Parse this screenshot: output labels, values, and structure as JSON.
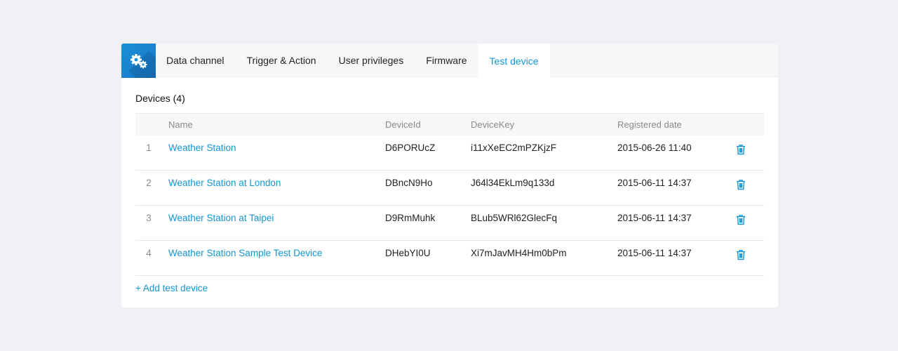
{
  "tabs": [
    {
      "label": "Data channel",
      "active": false
    },
    {
      "label": "Trigger & Action",
      "active": false
    },
    {
      "label": "User privileges",
      "active": false
    },
    {
      "label": "Firmware",
      "active": false
    },
    {
      "label": "Test device",
      "active": true
    }
  ],
  "header_icon": "gears-icon",
  "devices": {
    "title": "Devices (4)",
    "columns": [
      "",
      "Name",
      "DeviceId",
      "DeviceKey",
      "Registered date",
      ""
    ],
    "rows": [
      {
        "index": "1",
        "name": "Weather Station",
        "device_id": "D6PORUcZ",
        "device_key": "i11xXeEC2mPZKjzF",
        "registered": "2015-06-26 11:40"
      },
      {
        "index": "2",
        "name": "Weather Station at London",
        "device_id": "DBncN9Ho",
        "device_key": "J64l34EkLm9q133d",
        "registered": "2015-06-11 14:37"
      },
      {
        "index": "3",
        "name": "Weather Station at Taipei",
        "device_id": "D9RmMuhk",
        "device_key": "BLub5WRl62GlecFq",
        "registered": "2015-06-11 14:37"
      },
      {
        "index": "4",
        "name": "Weather Station Sample Test Device",
        "device_id": "DHebYI0U",
        "device_key": "Xi7mJavMH4Hm0bPm",
        "registered": "2015-06-11 14:37"
      }
    ],
    "delete_icon": "trash-icon",
    "add_label": "+ Add test device"
  },
  "colors": {
    "accent": "#1596d4",
    "badge": "#1a8fd8",
    "background": "#f0f1f5"
  }
}
